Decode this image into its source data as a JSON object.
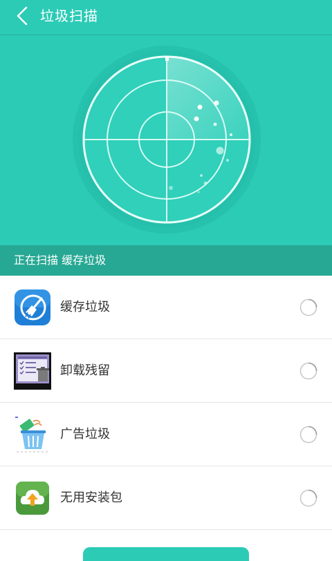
{
  "header": {
    "title": "垃圾扫描"
  },
  "status": {
    "prefix": "正在扫描",
    "target": "缓存垃圾"
  },
  "items": [
    {
      "label": "缓存垃圾",
      "icon": "broom-icon",
      "selected": false
    },
    {
      "label": "卸载残留",
      "icon": "uninstall-residue-icon",
      "selected": false
    },
    {
      "label": "广告垃圾",
      "icon": "ad-trash-icon",
      "selected": false
    },
    {
      "label": "无用安装包",
      "icon": "package-upload-icon",
      "selected": false
    }
  ],
  "colors": {
    "accent": "#2ccbb6",
    "accent_dark": "#27a894",
    "text": "#333333"
  }
}
